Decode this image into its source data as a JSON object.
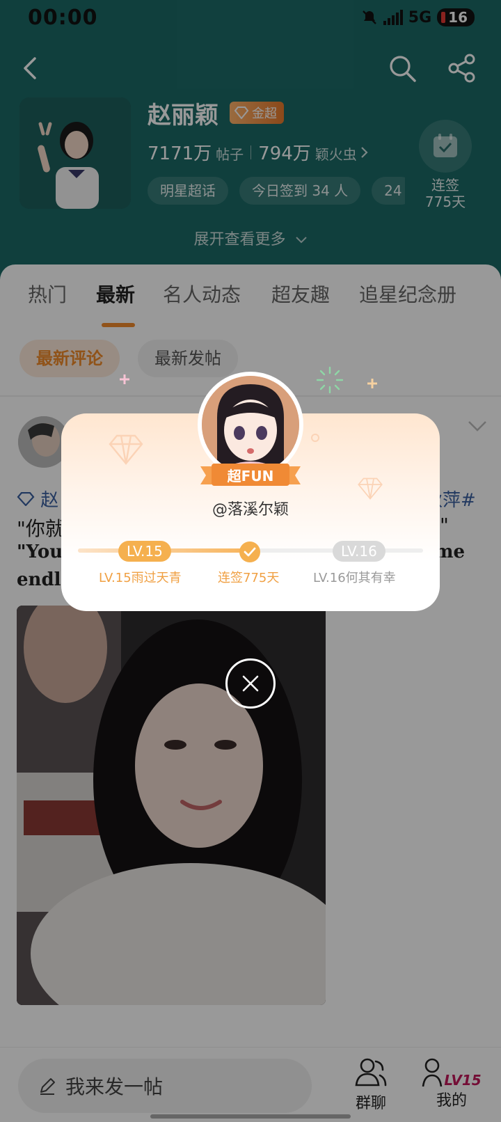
{
  "status_bar": {
    "time": "00:00",
    "network": "5G",
    "battery": "16"
  },
  "topic": {
    "name": "赵丽颖",
    "badge": "金超",
    "posts_count": "7171万",
    "posts_unit": "帖子",
    "fans_count": "794万",
    "fans_unit": "颖火虫",
    "tags": [
      "明星超话",
      "今日签到 34 人",
      "24"
    ],
    "checkin_label": "连签",
    "checkin_days": "775天",
    "expand": "展开查看更多"
  },
  "tabs": [
    "热门",
    "最新",
    "名人动态",
    "超友趣",
    "追星纪念册"
  ],
  "active_tab": "最新",
  "subtabs": [
    "最新评论",
    "最新发帖"
  ],
  "post": {
    "topic_left": "赵",
    "topic_right": "秋萍#",
    "line1_start": "\"你就",
    "line1_end": "\"",
    "line2_start": "\"You",
    "line2_end": "me",
    "line3": "endle"
  },
  "popup": {
    "badge": "超FUN",
    "username": "@落溪尔颖",
    "level_current": "LV.15",
    "level_next": "LV.16",
    "caption_current": "LV.15雨过天青",
    "caption_mid": "连签775天",
    "caption_next": "LV.16何其有幸",
    "progress": 0.5
  },
  "bottom_bar": {
    "compose_placeholder": "我来发一帖",
    "group_chat": "群聊",
    "mine": "我的",
    "mine_level": "LV15"
  },
  "colors": {
    "header_bg": "#1c6a67",
    "accent": "#f28a2c",
    "level_gold": "#f5b04f",
    "link_blue": "#3a5fa0"
  },
  "icons": [
    "back-icon",
    "search-icon",
    "share-icon",
    "calendar-check-icon",
    "chevron-down-icon",
    "diamond-icon",
    "pencil-icon",
    "group-chat-icon",
    "user-icon",
    "close-icon",
    "check-icon"
  ]
}
